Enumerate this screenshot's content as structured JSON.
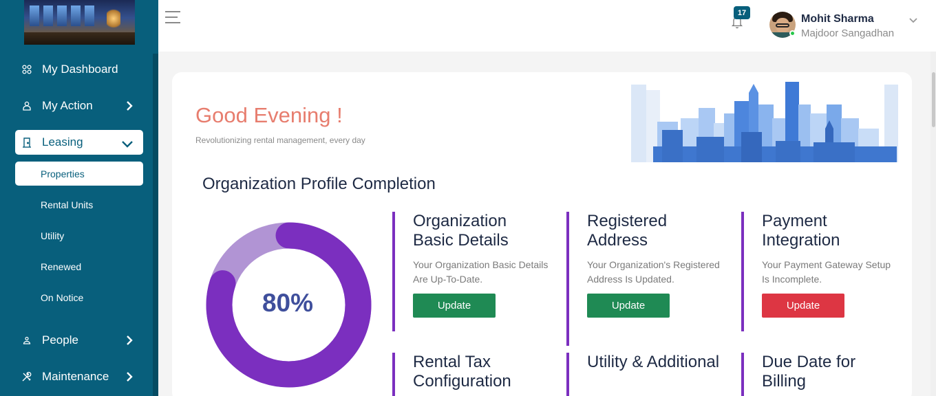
{
  "sidebar": {
    "items": [
      {
        "label": "My Dashboard",
        "icon": "grid-icon"
      },
      {
        "label": "My Action",
        "icon": "user-action-icon"
      },
      {
        "label": "Leasing",
        "icon": "door-icon"
      },
      {
        "label": "People",
        "icon": "person-icon"
      },
      {
        "label": "Maintenance",
        "icon": "tools-icon"
      }
    ],
    "leasing_subitems": [
      "Properties",
      "Rental Units",
      "Utility",
      "Renewed",
      "On Notice"
    ]
  },
  "header": {
    "notification_count": "17",
    "user_name": "Mohit Sharma",
    "user_org": "Majdoor Sangadhan"
  },
  "main": {
    "greeting": "Good Evening !",
    "tagline": "Revolutionizing rental management, every day",
    "section_title": "Organization Profile Completion",
    "completion_percent": "80%",
    "completion_value": 80,
    "tiles": [
      {
        "title": "Organization Basic Details",
        "desc": "Your Organization Basic Details Are Up-To-Date.",
        "button": "Update",
        "status": "complete"
      },
      {
        "title": "Registered Address",
        "desc": "Your Organization's Registered Address Is Updated.",
        "button": "Update",
        "status": "complete"
      },
      {
        "title": "Payment Integration",
        "desc": "Your Payment Gateway Setup Is Incomplete.",
        "button": "Update",
        "status": "incomplete"
      },
      {
        "title": "Rental Tax Configuration"
      },
      {
        "title": "Utility & Additional"
      },
      {
        "title": "Due Date for Billing"
      }
    ]
  },
  "colors": {
    "sidebar": "#085f7c",
    "greeting": "#e77d6e",
    "accent_purple": "#7b2fbf",
    "button_green": "#1f8a54",
    "button_red": "#dd3643"
  }
}
